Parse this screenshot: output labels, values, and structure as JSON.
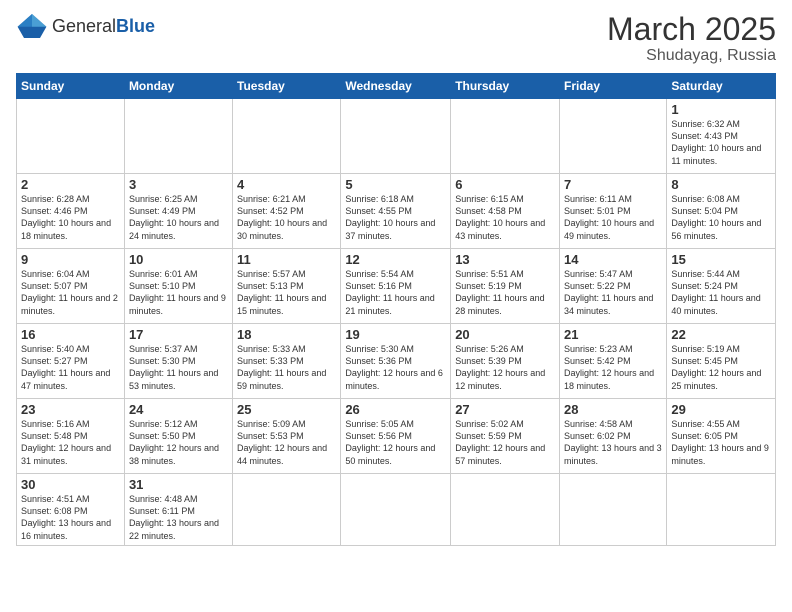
{
  "header": {
    "logo_general": "General",
    "logo_blue": "Blue",
    "month": "March 2025",
    "location": "Shudayag, Russia"
  },
  "weekdays": [
    "Sunday",
    "Monday",
    "Tuesday",
    "Wednesday",
    "Thursday",
    "Friday",
    "Saturday"
  ],
  "days": {
    "d1": {
      "num": "1",
      "sunrise": "6:32 AM",
      "sunset": "4:43 PM",
      "daylight": "10 hours and 11 minutes."
    },
    "d2": {
      "num": "2",
      "sunrise": "6:28 AM",
      "sunset": "4:46 PM",
      "daylight": "10 hours and 18 minutes."
    },
    "d3": {
      "num": "3",
      "sunrise": "6:25 AM",
      "sunset": "4:49 PM",
      "daylight": "10 hours and 24 minutes."
    },
    "d4": {
      "num": "4",
      "sunrise": "6:21 AM",
      "sunset": "4:52 PM",
      "daylight": "10 hours and 30 minutes."
    },
    "d5": {
      "num": "5",
      "sunrise": "6:18 AM",
      "sunset": "4:55 PM",
      "daylight": "10 hours and 37 minutes."
    },
    "d6": {
      "num": "6",
      "sunrise": "6:15 AM",
      "sunset": "4:58 PM",
      "daylight": "10 hours and 43 minutes."
    },
    "d7": {
      "num": "7",
      "sunrise": "6:11 AM",
      "sunset": "5:01 PM",
      "daylight": "10 hours and 49 minutes."
    },
    "d8": {
      "num": "8",
      "sunrise": "6:08 AM",
      "sunset": "5:04 PM",
      "daylight": "10 hours and 56 minutes."
    },
    "d9": {
      "num": "9",
      "sunrise": "6:04 AM",
      "sunset": "5:07 PM",
      "daylight": "11 hours and 2 minutes."
    },
    "d10": {
      "num": "10",
      "sunrise": "6:01 AM",
      "sunset": "5:10 PM",
      "daylight": "11 hours and 9 minutes."
    },
    "d11": {
      "num": "11",
      "sunrise": "5:57 AM",
      "sunset": "5:13 PM",
      "daylight": "11 hours and 15 minutes."
    },
    "d12": {
      "num": "12",
      "sunrise": "5:54 AM",
      "sunset": "5:16 PM",
      "daylight": "11 hours and 21 minutes."
    },
    "d13": {
      "num": "13",
      "sunrise": "5:51 AM",
      "sunset": "5:19 PM",
      "daylight": "11 hours and 28 minutes."
    },
    "d14": {
      "num": "14",
      "sunrise": "5:47 AM",
      "sunset": "5:22 PM",
      "daylight": "11 hours and 34 minutes."
    },
    "d15": {
      "num": "15",
      "sunrise": "5:44 AM",
      "sunset": "5:24 PM",
      "daylight": "11 hours and 40 minutes."
    },
    "d16": {
      "num": "16",
      "sunrise": "5:40 AM",
      "sunset": "5:27 PM",
      "daylight": "11 hours and 47 minutes."
    },
    "d17": {
      "num": "17",
      "sunrise": "5:37 AM",
      "sunset": "5:30 PM",
      "daylight": "11 hours and 53 minutes."
    },
    "d18": {
      "num": "18",
      "sunrise": "5:33 AM",
      "sunset": "5:33 PM",
      "daylight": "11 hours and 59 minutes."
    },
    "d19": {
      "num": "19",
      "sunrise": "5:30 AM",
      "sunset": "5:36 PM",
      "daylight": "12 hours and 6 minutes."
    },
    "d20": {
      "num": "20",
      "sunrise": "5:26 AM",
      "sunset": "5:39 PM",
      "daylight": "12 hours and 12 minutes."
    },
    "d21": {
      "num": "21",
      "sunrise": "5:23 AM",
      "sunset": "5:42 PM",
      "daylight": "12 hours and 18 minutes."
    },
    "d22": {
      "num": "22",
      "sunrise": "5:19 AM",
      "sunset": "5:45 PM",
      "daylight": "12 hours and 25 minutes."
    },
    "d23": {
      "num": "23",
      "sunrise": "5:16 AM",
      "sunset": "5:48 PM",
      "daylight": "12 hours and 31 minutes."
    },
    "d24": {
      "num": "24",
      "sunrise": "5:12 AM",
      "sunset": "5:50 PM",
      "daylight": "12 hours and 38 minutes."
    },
    "d25": {
      "num": "25",
      "sunrise": "5:09 AM",
      "sunset": "5:53 PM",
      "daylight": "12 hours and 44 minutes."
    },
    "d26": {
      "num": "26",
      "sunrise": "5:05 AM",
      "sunset": "5:56 PM",
      "daylight": "12 hours and 50 minutes."
    },
    "d27": {
      "num": "27",
      "sunrise": "5:02 AM",
      "sunset": "5:59 PM",
      "daylight": "12 hours and 57 minutes."
    },
    "d28": {
      "num": "28",
      "sunrise": "4:58 AM",
      "sunset": "6:02 PM",
      "daylight": "13 hours and 3 minutes."
    },
    "d29": {
      "num": "29",
      "sunrise": "4:55 AM",
      "sunset": "6:05 PM",
      "daylight": "13 hours and 9 minutes."
    },
    "d30": {
      "num": "30",
      "sunrise": "4:51 AM",
      "sunset": "6:08 PM",
      "daylight": "13 hours and 16 minutes."
    },
    "d31": {
      "num": "31",
      "sunrise": "4:48 AM",
      "sunset": "6:11 PM",
      "daylight": "13 hours and 22 minutes."
    }
  }
}
